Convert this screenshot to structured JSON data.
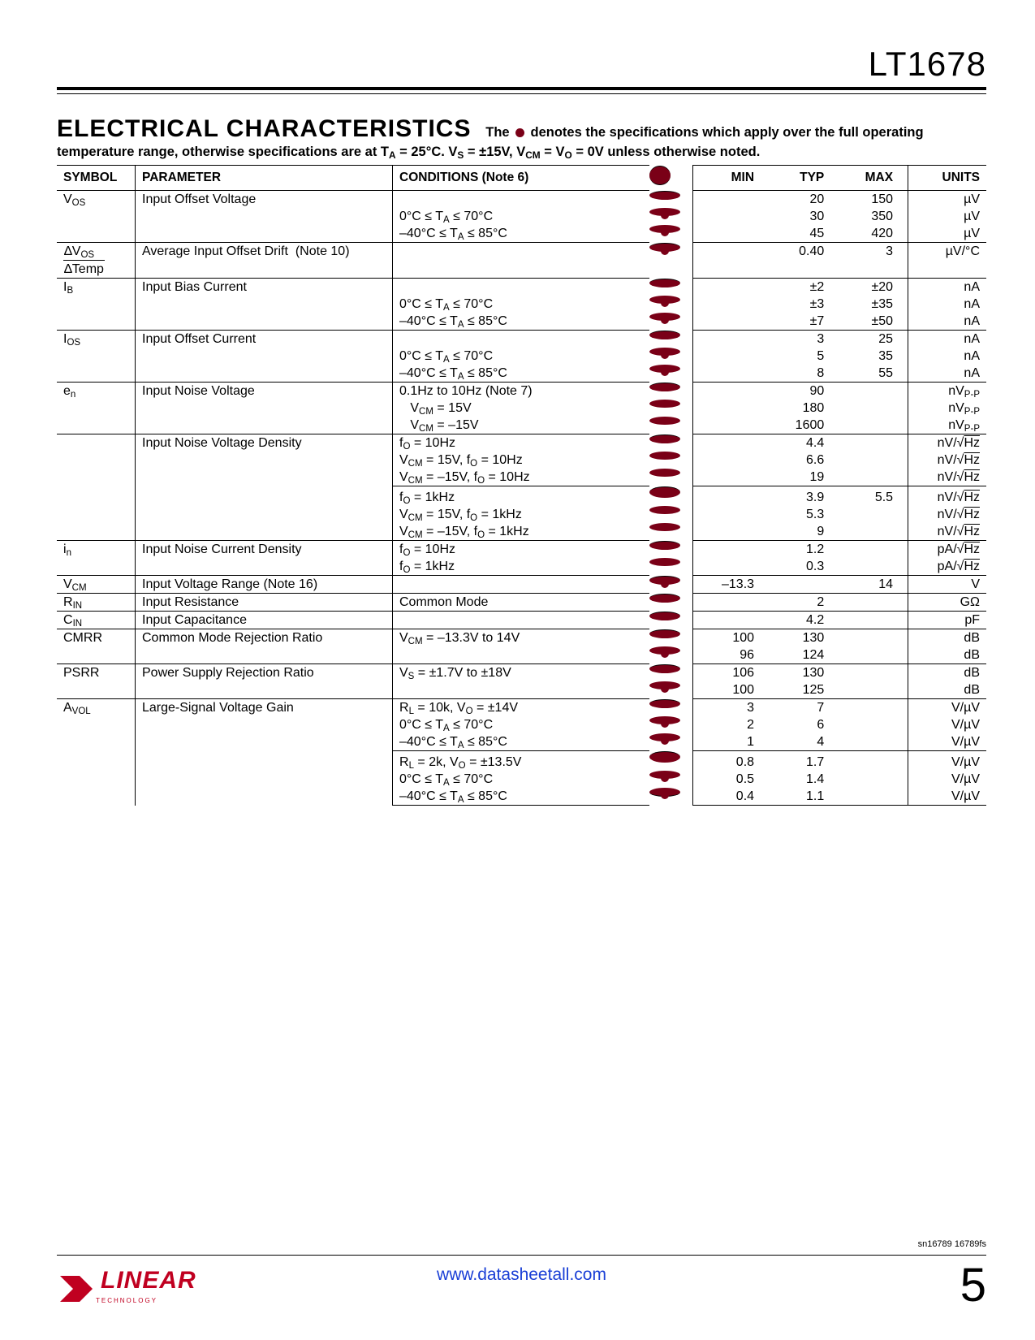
{
  "header": {
    "part_number": "LT1678"
  },
  "section": {
    "title": "ELECTRICAL CHARACTERISTICS",
    "subtitle_a": "The",
    "subtitle_b": "denotes the specifications which apply over the full operating",
    "subtitle_c": "temperature range, otherwise specifications are at T",
    "subtitle_c_sub": "A",
    "subtitle_d": " = 25°C. V",
    "subtitle_d_sub": "S",
    "subtitle_e": " = ±15V, V",
    "subtitle_e_sub": "CM",
    "subtitle_f": " = V",
    "subtitle_f_sub": "O",
    "subtitle_g": " = 0V unless otherwise noted."
  },
  "columns": {
    "symbol": "SYMBOL",
    "parameter": "PARAMETER",
    "conditions": "CONDITIONS (Note 6)",
    "min": "MIN",
    "typ": "TYP",
    "max": "MAX",
    "units": "UNITS"
  },
  "rows": [
    {
      "sep": true,
      "sym": "V<sub>OS</sub>",
      "param": "Input Offset Voltage",
      "lines": [
        {
          "cond": "",
          "dot": false,
          "min": "",
          "typ": "20",
          "max": "150",
          "unit": "µV"
        },
        {
          "cond": "0°C ≤ T<sub>A</sub> ≤ 70°C",
          "dot": true,
          "min": "",
          "typ": "30",
          "max": "350",
          "unit": "µV"
        },
        {
          "cond": "–40°C ≤ T<sub>A</sub> ≤ 85°C",
          "dot": true,
          "min": "",
          "typ": "45",
          "max": "420",
          "unit": "µV"
        }
      ]
    },
    {
      "sep": true,
      "sym": "<span class='frac'><span class='num'>∆V<sub>OS</sub></span><span class='den'>∆Temp</span></span>",
      "param": "Average Input Offset Drift&nbsp;&nbsp;(Note 10)",
      "lines": [
        {
          "cond": "",
          "dot": true,
          "min": "",
          "typ": "0.40",
          "max": "3",
          "unit": "µV/°C"
        }
      ]
    },
    {
      "sep": true,
      "sym": "I<sub>B</sub>",
      "param": "Input Bias Current",
      "lines": [
        {
          "cond": "",
          "dot": false,
          "min": "",
          "typ": "±2",
          "max": "±20",
          "unit": "nA"
        },
        {
          "cond": "0°C ≤ T<sub>A</sub> ≤ 70°C",
          "dot": true,
          "min": "",
          "typ": "±3",
          "max": "±35",
          "unit": "nA"
        },
        {
          "cond": "–40°C ≤ T<sub>A</sub> ≤ 85°C",
          "dot": true,
          "min": "",
          "typ": "±7",
          "max": "±50",
          "unit": "nA"
        }
      ]
    },
    {
      "sep": true,
      "sym": "I<sub>OS</sub>",
      "param": "Input Offset Current",
      "lines": [
        {
          "cond": "",
          "dot": false,
          "min": "",
          "typ": "3",
          "max": "25",
          "unit": "nA"
        },
        {
          "cond": "0°C ≤ T<sub>A</sub> ≤ 70°C",
          "dot": true,
          "min": "",
          "typ": "5",
          "max": "35",
          "unit": "nA"
        },
        {
          "cond": "–40°C ≤ T<sub>A</sub> ≤ 85°C",
          "dot": true,
          "min": "",
          "typ": "8",
          "max": "55",
          "unit": "nA"
        }
      ]
    },
    {
      "sep": true,
      "sym": "e<sub>n</sub>",
      "param": "Input Noise Voltage",
      "lines": [
        {
          "cond": "0.1Hz to 10Hz (Note 7)",
          "dot": false,
          "min": "",
          "typ": "90",
          "max": "",
          "unit": "nV<sub>P-P</sub>"
        },
        {
          "cond": "&nbsp;&nbsp;&nbsp;V<sub>CM</sub> = 15V",
          "dot": false,
          "min": "",
          "typ": "180",
          "max": "",
          "unit": "nV<sub>P-P</sub>"
        },
        {
          "cond": "&nbsp;&nbsp;&nbsp;V<sub>CM</sub> = –15V",
          "dot": false,
          "min": "",
          "typ": "1600",
          "max": "",
          "unit": "nV<sub>P-P</sub>"
        }
      ]
    },
    {
      "sep": true,
      "sym": "",
      "param": "Input Noise Voltage Density",
      "lines": [
        {
          "cond": "f<sub>O</sub> = 10Hz",
          "dot": false,
          "min": "",
          "typ": "4.4",
          "max": "",
          "unit": "nV/√<span class='sqrt'>Hz</span>"
        },
        {
          "cond": "V<sub>CM</sub> = 15V, f<sub>O</sub> = 10Hz",
          "dot": false,
          "min": "",
          "typ": "6.6",
          "max": "",
          "unit": "nV/√<span class='sqrt'>Hz</span>"
        },
        {
          "cond": "V<sub>CM</sub> = –15V, f<sub>O</sub> = 10Hz",
          "dot": false,
          "min": "",
          "typ": "19",
          "max": "",
          "unit": "nV/√<span class='sqrt'>Hz</span>"
        }
      ],
      "sublines": [
        {
          "cond": "f<sub>O</sub> = 1kHz",
          "dot": false,
          "min": "",
          "typ": "3.9",
          "max": "5.5",
          "unit": "nV/√<span class='sqrt'>Hz</span>"
        },
        {
          "cond": "V<sub>CM</sub> = 15V, f<sub>O</sub> = 1kHz",
          "dot": false,
          "min": "",
          "typ": "5.3",
          "max": "",
          "unit": "nV/√<span class='sqrt'>Hz</span>"
        },
        {
          "cond": "V<sub>CM</sub> = –15V, f<sub>O</sub> = 1kHz",
          "dot": false,
          "min": "",
          "typ": "9",
          "max": "",
          "unit": "nV/√<span class='sqrt'>Hz</span>"
        }
      ]
    },
    {
      "sep": true,
      "sym": "i<sub>n</sub>",
      "param": "Input Noise Current Density",
      "lines": [
        {
          "cond": "f<sub>O</sub> = 10Hz",
          "dot": false,
          "min": "",
          "typ": "1.2",
          "max": "",
          "unit": "pA/√<span class='sqrt'>Hz</span>"
        },
        {
          "cond": "f<sub>O</sub> = 1kHz",
          "dot": false,
          "min": "",
          "typ": "0.3",
          "max": "",
          "unit": "pA/√<span class='sqrt'>Hz</span>"
        }
      ]
    },
    {
      "sep": true,
      "sym": "V<sub>CM</sub>",
      "param": "Input Voltage Range (Note 16)",
      "lines": [
        {
          "cond": "",
          "dot": true,
          "min": "–13.3",
          "typ": "",
          "max": "14",
          "unit": "V"
        }
      ]
    },
    {
      "sep": true,
      "sym": "R<sub>IN</sub>",
      "param": "Input Resistance",
      "lines": [
        {
          "cond": "Common Mode",
          "dot": false,
          "min": "",
          "typ": "2",
          "max": "",
          "unit": "GΩ"
        }
      ]
    },
    {
      "sep": true,
      "sym": "C<sub>IN</sub>",
      "param": "Input Capacitance",
      "lines": [
        {
          "cond": "",
          "dot": false,
          "min": "",
          "typ": "4.2",
          "max": "",
          "unit": "pF"
        }
      ]
    },
    {
      "sep": true,
      "sym": "CMRR",
      "param": "Common Mode Rejection Ratio",
      "lines": [
        {
          "cond": "V<sub>CM</sub> = –13.3V to 14V",
          "dot": false,
          "min": "100",
          "typ": "130",
          "max": "",
          "unit": "dB"
        },
        {
          "cond": "",
          "dot": true,
          "min": "96",
          "typ": "124",
          "max": "",
          "unit": "dB"
        }
      ]
    },
    {
      "sep": true,
      "sym": "PSRR",
      "param": "Power Supply Rejection Ratio",
      "lines": [
        {
          "cond": "V<sub>S</sub> = ±1.7V to ±18V",
          "dot": false,
          "min": "106",
          "typ": "130",
          "max": "",
          "unit": "dB"
        },
        {
          "cond": "",
          "dot": true,
          "min": "100",
          "typ": "125",
          "max": "",
          "unit": "dB"
        }
      ]
    },
    {
      "sep": true,
      "sym": "A<sub>VOL</sub>",
      "param": "Large-Signal Voltage Gain",
      "lines": [
        {
          "cond": "R<sub>L</sub> = 10k, V<sub>O</sub> = ±14V",
          "dot": false,
          "min": "3",
          "typ": "7",
          "max": "",
          "unit": "V/µV"
        },
        {
          "cond": "0°C ≤ T<sub>A</sub> ≤ 70°C",
          "dot": true,
          "min": "2",
          "typ": "6",
          "max": "",
          "unit": "V/µV"
        },
        {
          "cond": "–40°C ≤ T<sub>A</sub> ≤ 85°C",
          "dot": true,
          "min": "1",
          "typ": "4",
          "max": "",
          "unit": "V/µV"
        }
      ],
      "sublines": [
        {
          "cond": "R<sub>L</sub> = 2k, V<sub>O</sub> = ±13.5V",
          "dot": false,
          "min": "0.8",
          "typ": "1.7",
          "max": "",
          "unit": "V/µV"
        },
        {
          "cond": "0°C ≤ T<sub>A</sub> ≤ 70°C",
          "dot": true,
          "min": "0.5",
          "typ": "1.4",
          "max": "",
          "unit": "V/µV"
        },
        {
          "cond": "–40°C ≤ T<sub>A</sub> ≤ 85°C",
          "dot": true,
          "min": "0.4",
          "typ": "1.1",
          "max": "",
          "unit": "V/µV"
        }
      ],
      "final": true
    }
  ],
  "footer": {
    "sn": "sn16789 16789fs",
    "url": "www.datasheetall.com",
    "page": "5",
    "logo_text": "LINEAR",
    "logo_sub": "TECHNOLOGY"
  }
}
